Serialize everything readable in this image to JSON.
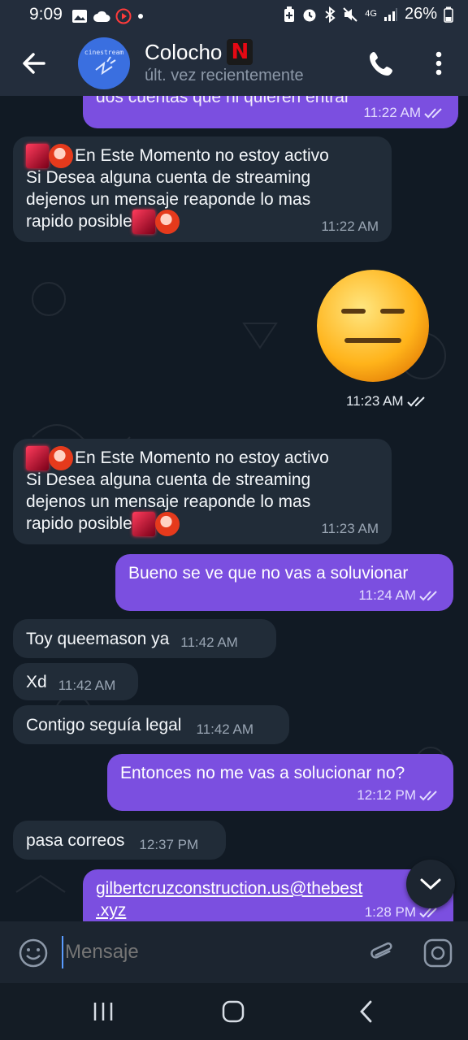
{
  "status_bar": {
    "time": "9:09",
    "left_icons": [
      "image-icon",
      "cloud-icon",
      "record-icon",
      "dot-icon"
    ],
    "right_icons": [
      "battery-saver-icon",
      "alarm-icon",
      "bluetooth-icon",
      "mute-icon",
      "4g-icon",
      "signal-icon"
    ],
    "network": "4G",
    "battery": "26%"
  },
  "header": {
    "name": "Colocho",
    "name_badge": "N",
    "status": "últ. vez recientemente",
    "avatar_text": "cinestream"
  },
  "messages": [
    {
      "direction": "out",
      "text": "dos cuentas que ni quieren entrar",
      "time": "11:22 AM",
      "read": true
    },
    {
      "direction": "in",
      "line1": "En Este Momento no estoy activo",
      "line2": "Si Desea alguna cuenta de streaming",
      "line3": "dejenos un mensaje reaponde lo mas",
      "line4": "rapido posible",
      "time": "11:22 AM"
    },
    {
      "direction": "out",
      "emoji": "😑",
      "time": "11:23 AM",
      "read": true
    },
    {
      "direction": "in",
      "line1": "En Este Momento no estoy activo",
      "line2": "Si Desea alguna cuenta de streaming",
      "line3": "dejenos un mensaje reaponde lo mas",
      "line4": "rapido posible",
      "time": "11:23 AM"
    },
    {
      "direction": "out",
      "text": "Bueno se ve que no vas a soluvionar",
      "time": "11:24 AM",
      "read": true
    },
    {
      "direction": "in",
      "text": "Toy queemason ya",
      "time": "11:42 AM"
    },
    {
      "direction": "in",
      "text": "Xd",
      "time": "11:42 AM"
    },
    {
      "direction": "in",
      "text": "Contigo seguía legal",
      "time": "11:42 AM"
    },
    {
      "direction": "out",
      "text": "Entonces no me vas a solucionar no?",
      "time": "12:12 PM",
      "read": true
    },
    {
      "direction": "in",
      "text": "pasa correos",
      "time": "12:37 PM"
    },
    {
      "direction": "out",
      "link1": "gilbertcruzconstruction.us@thebest",
      "link2": ".xyz",
      "time": "1:28 PM",
      "read": true
    }
  ],
  "input": {
    "placeholder": "Mensaje"
  },
  "colors": {
    "outgoing_bubble": "#7b4fe0",
    "incoming_bubble": "#212c38",
    "header_bg": "#232d3c",
    "link": "#ffffff"
  }
}
